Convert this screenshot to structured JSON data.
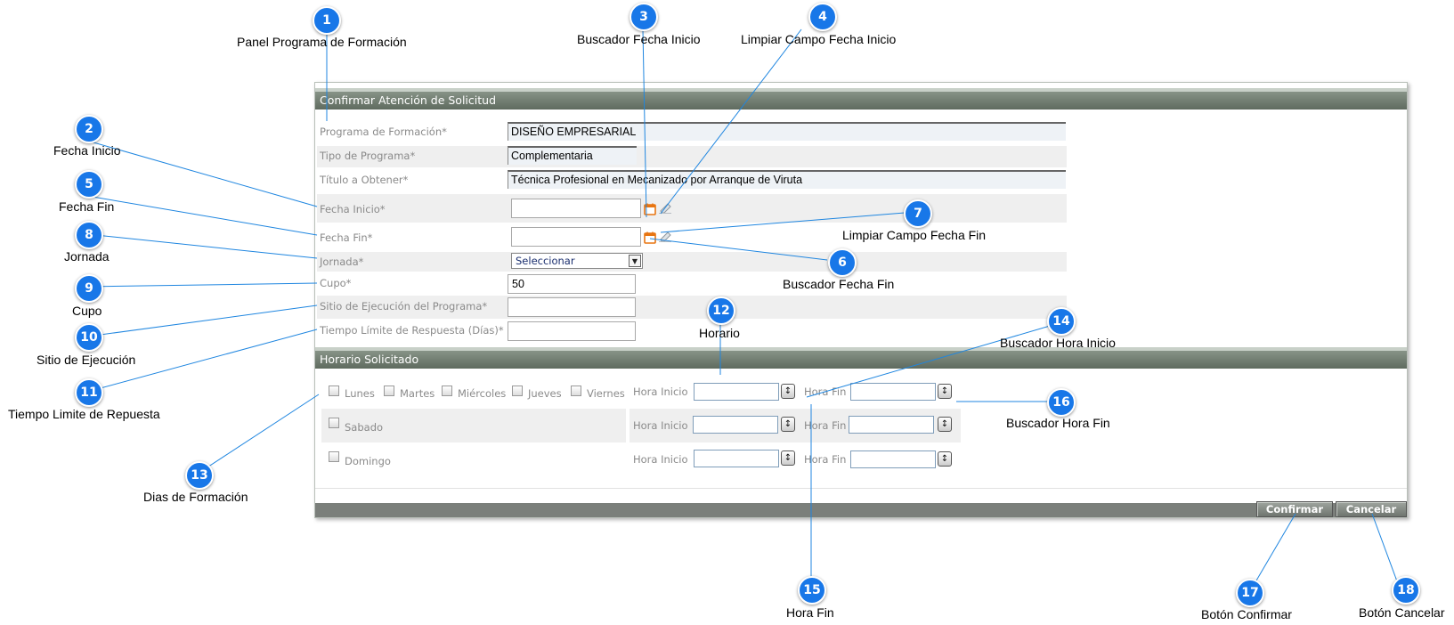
{
  "callouts": [
    {
      "num": "1",
      "label": "Panel Programa de Formación"
    },
    {
      "num": "2",
      "label": "Fecha Inicio"
    },
    {
      "num": "3",
      "label": "Buscador Fecha Inicio"
    },
    {
      "num": "4",
      "label": "Limpiar Campo Fecha Inicio"
    },
    {
      "num": "5",
      "label": "Fecha Fin"
    },
    {
      "num": "6",
      "label": "Buscador Fecha Fin"
    },
    {
      "num": "7",
      "label": "Limpiar Campo Fecha Fin"
    },
    {
      "num": "8",
      "label": "Jornada"
    },
    {
      "num": "9",
      "label": "Cupo"
    },
    {
      "num": "10",
      "label": "Sitio de Ejecución"
    },
    {
      "num": "11",
      "label": "Tiempo Limite de Repuesta"
    },
    {
      "num": "12",
      "label": "Horario"
    },
    {
      "num": "13",
      "label": "Dias de Formación"
    },
    {
      "num": "14",
      "label": "Buscador Hora Inicio"
    },
    {
      "num": "15",
      "label": "Hora Fin"
    },
    {
      "num": "16",
      "label": "Buscador Hora Fin"
    },
    {
      "num": "17",
      "label": "Botón Confirmar"
    },
    {
      "num": "18",
      "label": "Botón Cancelar"
    }
  ],
  "panel": {
    "title": "Confirmar Atención de Solicitud",
    "fields": {
      "programa_label": "Programa de Formación*",
      "programa_value": "DISEÑO EMPRESARIAL",
      "tipo_label": "Tipo de Programa*",
      "tipo_value": "Complementaria",
      "titulo_label": "Título a Obtener*",
      "titulo_value": "Técnica Profesional en Mecanizado por Arranque de Viruta",
      "fecha_inicio_label": "Fecha Inicio*",
      "fecha_inicio_value": "",
      "fecha_fin_label": "Fecha Fin*",
      "fecha_fin_value": "",
      "jornada_label": "Jornada*",
      "jornada_selected": "Seleccionar",
      "cupo_label": "Cupo*",
      "cupo_value": "50",
      "sitio_label": "Sitio de Ejecución del Programa*",
      "sitio_value": "",
      "tiempo_label": "Tiempo Límite de Respuesta (Días)*",
      "tiempo_value": ""
    }
  },
  "horario": {
    "title": "Horario Solicitado",
    "days": [
      "Lunes",
      "Martes",
      "Miércoles",
      "Jueves",
      "Viernes",
      "Sabado",
      "Domingo"
    ],
    "hora_inicio_label": "Hora Inicio",
    "hora_fin_label": "Hora Fin"
  },
  "buttons": {
    "confirmar": "Confirmar",
    "cancelar": "Cancelar"
  },
  "colors": {
    "badge": "#1877e8",
    "connector": "#1f86e0",
    "header_bar": "#6b776b",
    "calendar_icon": "#e87511"
  }
}
